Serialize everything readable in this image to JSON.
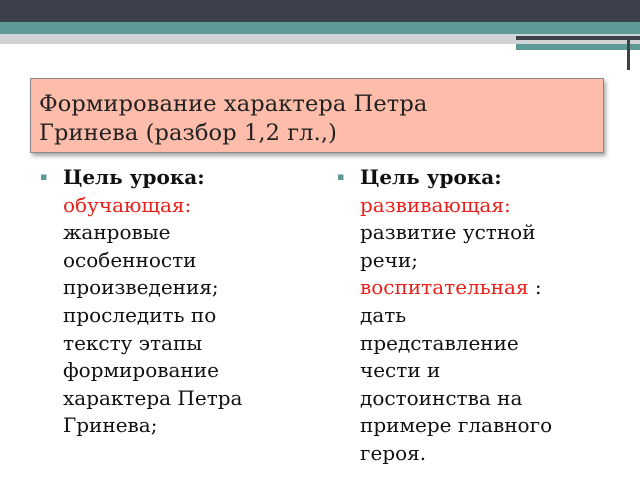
{
  "slide": {
    "title_line1": "Формирование характера Петра",
    "title_line2": "Гринева (разбор 1,2 гл.,)",
    "left": {
      "label": "Цель урока:",
      "subtype": "обучающая:",
      "lines": [
        "жанровые",
        "особенности",
        "произведения;",
        "проследить по",
        "тексту этапы",
        "формирование",
        "характера Петра",
        "Гринева;"
      ]
    },
    "right": {
      "label": "Цель урока:",
      "subtype1": "развивающая:",
      "lines1": [
        "развитие устной",
        "речи;"
      ],
      "subtype2": "воспитательная",
      "subtype2_suffix": " :",
      "lines2": [
        "дать",
        "представление",
        "чести и",
        "достоинства на",
        "примере главного",
        "героя."
      ]
    }
  },
  "colors": {
    "title_bg": "#fdbdaa",
    "accent_teal": "#5e9a98",
    "dark_bar": "#3c404b",
    "highlight_red": "#e8211c"
  },
  "icons": {
    "bullet": "bullet-square"
  }
}
